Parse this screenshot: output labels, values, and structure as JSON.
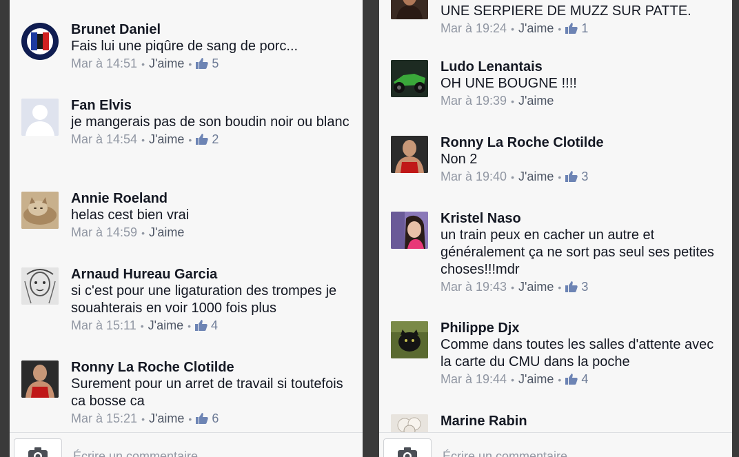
{
  "like_label": "J'aime",
  "left": {
    "comments": [
      {
        "name": "Brunet Daniel",
        "text": "Fais lui une piqûre de sang de porc...",
        "time": "Mar à 14:51",
        "likes": "5",
        "avatar": "badge-avatar"
      },
      {
        "name": "Fan Elvis",
        "text": "je mangerais pas de son boudin noir ou blanc",
        "time": "Mar à 14:54",
        "likes": "2",
        "avatar": "default-silhouette-avatar"
      },
      {
        "name": "Annie Roeland",
        "text": "helas cest bien vrai",
        "time": "Mar à 14:59",
        "likes": "",
        "avatar": "cat-photo-avatar"
      },
      {
        "name": "Arnaud Hureau Garcia",
        "text": "si c'est pour une ligaturation des trompes je souahterais en voir 1000 fois plus",
        "time": "Mar à 15:11",
        "likes": "4",
        "avatar": "drawing-avatar"
      },
      {
        "name": "Ronny La Roche Clotilde",
        "text": "Surement pour un arret de travail si toutefois ca bosse ca",
        "time": "Mar à 15:21",
        "likes": "6",
        "avatar": "man-photo-avatar"
      }
    ]
  },
  "right": {
    "partial": {
      "text": "UNE SERPIERE DE MUZZ SUR PATTE.",
      "time": "Mar à 19:24",
      "likes": "1"
    },
    "comments": [
      {
        "name": "Ludo Lenantais",
        "text": "OH UNE BOUGNE !!!!",
        "time": "Mar à 19:39",
        "likes": "",
        "avatar": "motorbike-avatar"
      },
      {
        "name": "Ronny La Roche Clotilde",
        "text": "Non 2",
        "time": "Mar à 19:40",
        "likes": "3",
        "avatar": "man-photo-avatar"
      },
      {
        "name": "Kristel Naso",
        "text": "un train peux en cacher un autre et généralement ça ne sort pas seul ses petites choses!!!mdr",
        "time": "Mar à 19:43",
        "likes": "3",
        "avatar": "woman-photo-avatar"
      },
      {
        "name": "Philippe Djx",
        "text": "Comme dans toutes les salles d'attente avec la carte du CMU dans la poche",
        "time": "Mar à 19:44",
        "likes": "4",
        "avatar": "panther-avatar"
      },
      {
        "name": "Marine Rabin",
        "text": "",
        "time": "",
        "likes": "",
        "avatar": "flower-avatar"
      }
    ]
  },
  "composer": {
    "left_prompt": "Écrire un commentaire...",
    "right_prompt": "Écrire un commentaire..."
  },
  "colors": {
    "name": "#141823",
    "meta": "#9197a3",
    "like": "#4e5665",
    "panel_bg": "#f7f7f7",
    "gap_bg": "#3a3a3a"
  }
}
